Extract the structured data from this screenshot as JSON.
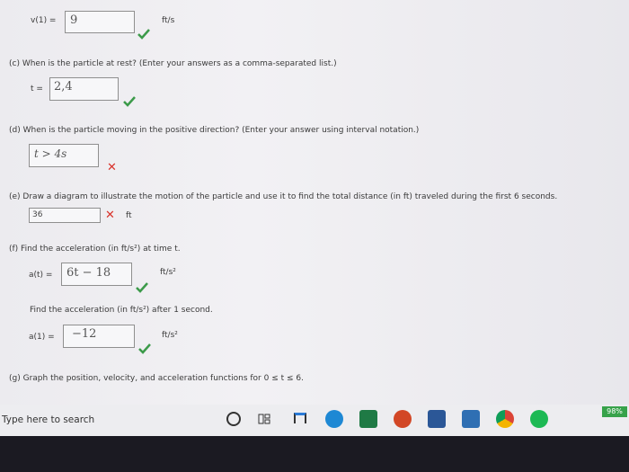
{
  "b": {
    "label": "v(1) =",
    "value": "9",
    "unit": "ft/s"
  },
  "c": {
    "question": "(c)   When is the particle at rest? (Enter your answers as a comma-separated list.)",
    "label": "t =",
    "value": "2,4"
  },
  "d": {
    "question": "(d)   When is the particle moving in the positive direction? (Enter your answer using interval notation.)",
    "value": "t > 4s"
  },
  "e": {
    "question": "(e)   Draw a diagram to illustrate the motion of the particle and use it to find the total distance (in ft) traveled during the first 6 seconds.",
    "value": "36",
    "unit": "ft"
  },
  "f": {
    "question": "(f)   Find the acceleration (in ft/s²) at time t.",
    "label": "a(t) =",
    "value": "6t − 18",
    "unit": "ft/s²",
    "question2": "Find the acceleration (in ft/s²) after 1 second.",
    "label2": "a(1) =",
    "value2": "−12",
    "unit2": "ft/s²"
  },
  "g": {
    "question": "(g)   Graph the position, velocity, and acceleration functions for 0 ≤ t ≤ 6."
  },
  "taskbar": {
    "search_placeholder": "Type here to search",
    "battery": "98%",
    "icons": [
      "cortana-circle-icon",
      "task-view-icon",
      "store-icon",
      "edge-icon",
      "excel-icon",
      "powerpoint-icon",
      "word-icon",
      "calendar-icon",
      "chrome-icon",
      "spotify-icon"
    ],
    "colors": {
      "excel": "#1f7a45",
      "powerpoint": "#d24726",
      "word": "#2b5797",
      "edge": "#1e88d4",
      "spotify": "#1db954",
      "chrome": "#4285f4",
      "check": "#3c9a4a",
      "cross": "#d9332b"
    }
  }
}
